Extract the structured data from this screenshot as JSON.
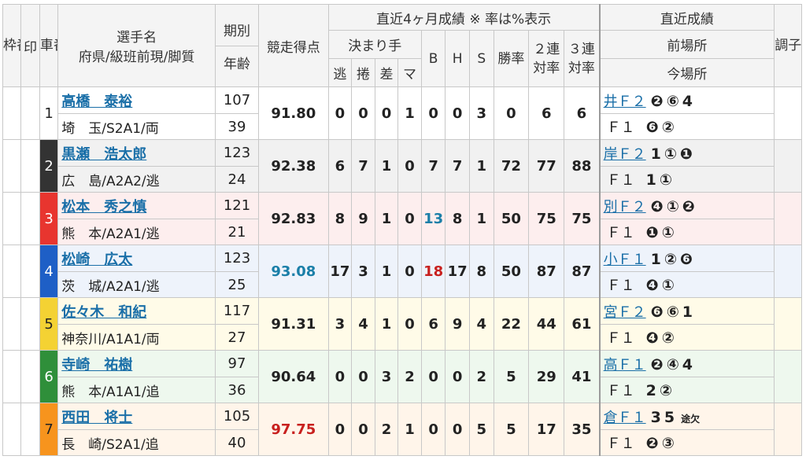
{
  "header": {
    "waku": "枠番",
    "shirushi": "印",
    "sha": "車番",
    "senshu": "選手名",
    "fuken": "府県/級班前現/脚質",
    "kibetsu": "期別",
    "nenrei": "年齢",
    "kyoso": "競走得点",
    "recent4": "直近4ヶ月成績 ※ 率は%表示",
    "kimarite": "決まり手",
    "nige": "逃",
    "makuri": "捲",
    "sashi": "差",
    "ma": "マ",
    "b": "B",
    "h": "H",
    "s": "S",
    "shoritsu": "勝率",
    "nirentai": "２連対率",
    "sanrentai": "３連対率",
    "recent": "直近成績",
    "zenba": "前場所",
    "konba": "今場所",
    "choshi": "調子"
  },
  "riders": [
    {
      "car": "1",
      "name": "高橋　泰裕",
      "region": "埼　玉/S2A1/両",
      "kibetsu": "107",
      "age": "39",
      "score": "91.80",
      "nige": "0",
      "makuri": "0",
      "sashi": "0",
      "ma": "1",
      "b": "0",
      "h": "0",
      "s": "3",
      "win": "0",
      "two": "6",
      "three": "6",
      "prev_link": "井Ｆ２",
      "prev": [
        "❷",
        "⑥",
        "4"
      ],
      "cur_label": "Ｆ１",
      "cur": [
        "❻",
        "②"
      ]
    },
    {
      "car": "2",
      "name": "黒瀬　浩太郎",
      "region": "広　島/A2A2/逃",
      "kibetsu": "123",
      "age": "24",
      "score": "92.38",
      "nige": "6",
      "makuri": "7",
      "sashi": "1",
      "ma": "0",
      "b": "7",
      "h": "7",
      "s": "1",
      "win": "72",
      "two": "77",
      "three": "88",
      "prev_link": "岸Ｆ２",
      "prev": [
        "1",
        "①",
        "❶"
      ],
      "cur_label": "Ｆ１",
      "cur": [
        "1",
        "①"
      ]
    },
    {
      "car": "3",
      "name": "松本　秀之慎",
      "region": "熊　本/A2A1/逃",
      "kibetsu": "121",
      "age": "21",
      "score": "92.83",
      "nige": "8",
      "makuri": "9",
      "sashi": "1",
      "ma": "0",
      "b": "13",
      "h": "8",
      "s": "1",
      "win": "50",
      "two": "75",
      "three": "75",
      "prev_link": "別Ｆ２",
      "prev": [
        "❹",
        "①",
        "❷"
      ],
      "cur_label": "Ｆ１",
      "cur": [
        "❶",
        "①"
      ]
    },
    {
      "car": "4",
      "name": "松崎　広太",
      "region": "茨　城/A2A1/逃",
      "kibetsu": "123",
      "age": "25",
      "score": "93.08",
      "nige": "17",
      "makuri": "3",
      "sashi": "1",
      "ma": "0",
      "b": "18",
      "h": "17",
      "s": "8",
      "win": "50",
      "two": "87",
      "three": "87",
      "prev_link": "小Ｆ１",
      "prev": [
        "1",
        "②",
        "❻"
      ],
      "cur_label": "Ｆ１",
      "cur": [
        "❹",
        "①"
      ]
    },
    {
      "car": "5",
      "name": "佐々木　和紀",
      "region": "神奈川/A1A1/両",
      "kibetsu": "117",
      "age": "27",
      "score": "91.31",
      "nige": "3",
      "makuri": "4",
      "sashi": "1",
      "ma": "0",
      "b": "6",
      "h": "9",
      "s": "4",
      "win": "22",
      "two": "44",
      "three": "61",
      "prev_link": "宮Ｆ２",
      "prev": [
        "❻",
        "⑥",
        "1"
      ],
      "cur_label": "Ｆ１",
      "cur": [
        "❹",
        "②"
      ]
    },
    {
      "car": "6",
      "name": "寺崎　祐樹",
      "region": "熊　本/A1A1/追",
      "kibetsu": "97",
      "age": "36",
      "score": "90.64",
      "nige": "0",
      "makuri": "0",
      "sashi": "3",
      "ma": "2",
      "b": "0",
      "h": "0",
      "s": "2",
      "win": "5",
      "two": "29",
      "three": "41",
      "prev_link": "高Ｆ１",
      "prev": [
        "❷",
        "④",
        "4"
      ],
      "cur_label": "Ｆ１",
      "cur": [
        "2",
        "②"
      ]
    },
    {
      "car": "7",
      "name": "西田　将士",
      "region": "長　崎/S2A1/追",
      "kibetsu": "105",
      "age": "40",
      "score": "97.75",
      "nige": "0",
      "makuri": "0",
      "sashi": "2",
      "ma": "1",
      "b": "0",
      "h": "0",
      "s": "5",
      "win": "5",
      "two": "17",
      "three": "35",
      "prev_link": "倉Ｆ１",
      "prev": [
        "3",
        "5"
      ],
      "prev_note": "途欠",
      "cur_label": "Ｆ１",
      "cur": [
        "❷",
        "③"
      ]
    }
  ],
  "styles": {
    "colors": [
      "#ffffff",
      "#333333",
      "#e8352f",
      "#1e5fc6",
      "#f4d233",
      "#2f8f3a",
      "#f7941d"
    ],
    "text_colors": [
      "#222222",
      "#ffffff",
      "#ffffff",
      "#ffffff",
      "#222222",
      "#ffffff",
      "#222222"
    ],
    "row_bg": [
      "#ffffff",
      "#f1f1f1",
      "#fdeeee",
      "#eef3fb",
      "#fffbe8",
      "#eef8ee",
      "#fff5ea"
    ]
  }
}
